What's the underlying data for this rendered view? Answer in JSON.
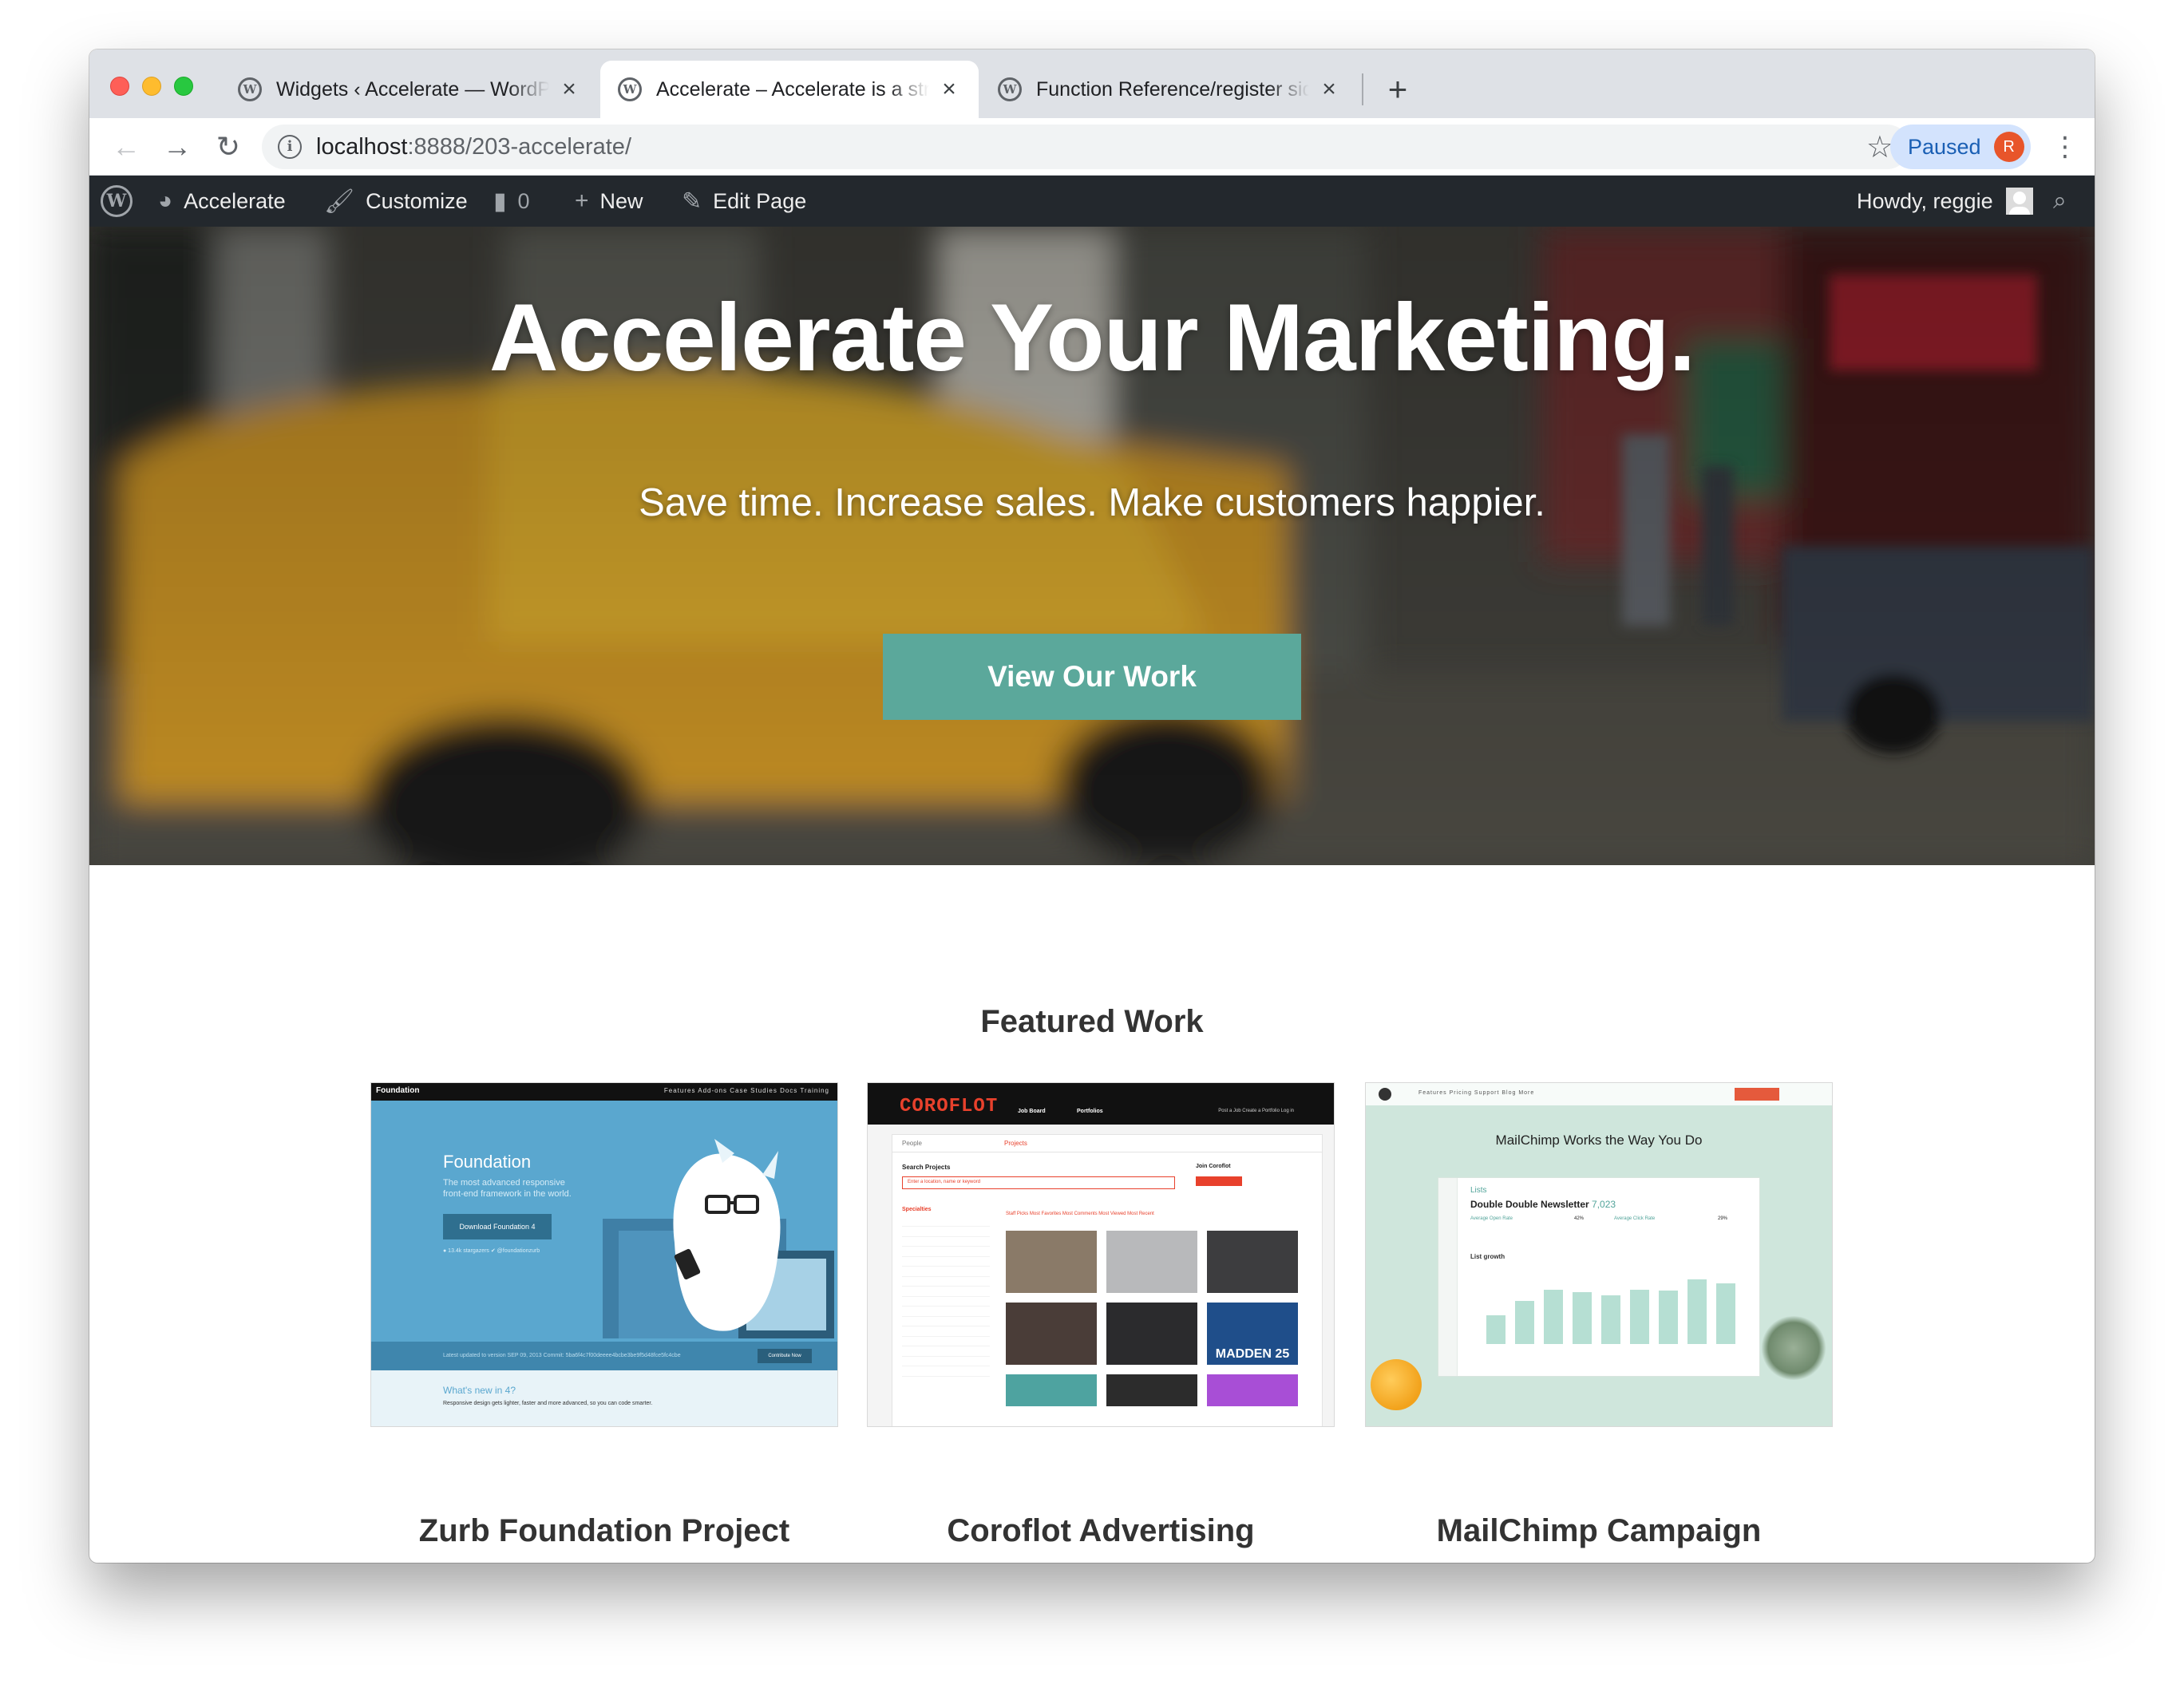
{
  "browser": {
    "tabs": [
      {
        "title": "Widgets ‹ Accelerate — WordPress",
        "active": false
      },
      {
        "title": "Accelerate – Accelerate is a strategy and marketing agency",
        "active": true
      },
      {
        "title": "Function Reference/register sidebar",
        "active": false
      }
    ],
    "new_tab_label": "+",
    "url_host": "localhost",
    "url_path": ":8888/203-accelerate/",
    "profile_status": "Paused",
    "profile_initial": "R"
  },
  "admin_bar": {
    "site_name": "Accelerate",
    "customize": "Customize",
    "comments_count": "0",
    "new_label": "New",
    "edit_page": "Edit Page",
    "greeting": "Howdy, reggie"
  },
  "hero": {
    "title": "Accelerate Your Marketing.",
    "subtitle": "Save time. Increase sales. Make customers happier.",
    "cta": "View Our Work"
  },
  "featured": {
    "heading": "Featured Work",
    "items": [
      {
        "title": "Zurb Foundation Project",
        "thumb": {
          "brand": "Foundation",
          "nav": "Features   Add-ons   Case Studies   Docs   Training",
          "heading": "Foundation",
          "desc": "The most advanced responsive front-end framework in the world.",
          "button": "Download Foundation 4",
          "stats": "● 13.4k stargazers     ✔ @foundationzurb",
          "strip_note": "Latest updated to version   SEP 09, 2013  Commit: 5ba6f4c7f00deeee4bcbe3be9f5d48fce5fc4cbe",
          "strip_button": "Contribute Now",
          "question": "What's new in 4?",
          "answer": "Responsive design gets lighter, faster and more advanced, so you can code smarter."
        }
      },
      {
        "title": "Coroflot Advertising",
        "thumb": {
          "brand": "COROFLOT",
          "nav1": "Job Board",
          "nav2": "Portfolios",
          "nav3": "Post a Job    Create a Portfolio    Log in",
          "tab_people": "People",
          "tab_projects": "Projects",
          "search_label": "Search Projects",
          "search_placeholder": "Enter a location, name or keyword",
          "join": "Join Coroflot",
          "specialties": "Specialties",
          "filters": "Staff Picks   Most Favorites   Most Comments   Most Viewed   Most Recent",
          "brand_tile": "MADDEN 25"
        }
      },
      {
        "title": "MailChimp Campaign",
        "thumb": {
          "nav": "Features   Pricing   Support   Blog   More",
          "heading": "MailChimp Works the Way You Do",
          "lists": "Lists",
          "newsletter": "Double Double Newsletter",
          "subscribers": "7,023",
          "growth": "List growth",
          "open_rate": "Average Open Rate",
          "open_rate_value": "42%",
          "click_rate": "Average Click Rate",
          "click_rate_value": "29%",
          "bars": [
            40,
            60,
            75,
            72,
            68,
            76,
            74,
            90,
            84
          ]
        }
      }
    ]
  },
  "colors": {
    "admin_bar": "#23282d",
    "cta": "#5ba89b",
    "heading_text": "#333333",
    "profile_pill": "#d3e3fd",
    "profile_avatar": "#e8552a"
  }
}
